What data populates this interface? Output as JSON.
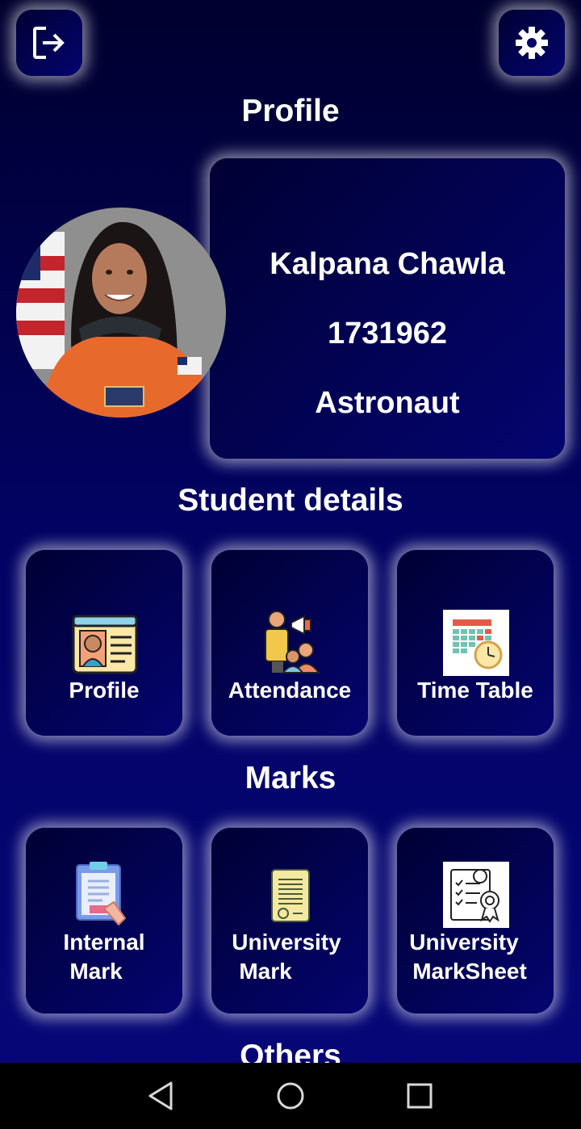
{
  "header": {
    "logout_icon": "logout-icon",
    "settings_icon": "gear-icon",
    "profile_title": "Profile"
  },
  "profile": {
    "name": "Kalpana Chawla",
    "id": "1731962",
    "role": "Astronaut"
  },
  "student_details": {
    "title": "Student details",
    "tiles": [
      {
        "label": "Profile",
        "icon": "profile-card-icon"
      },
      {
        "label": "Attendance",
        "icon": "attendance-icon"
      },
      {
        "label": "Time Table",
        "icon": "calendar-clock-icon"
      }
    ]
  },
  "marks": {
    "title": "Marks",
    "tiles": [
      {
        "line1": "Internal",
        "line2": "Mark",
        "icon": "clipboard-icon"
      },
      {
        "line1": "University",
        "line2": "Mark",
        "icon": "certificate-icon"
      },
      {
        "line1": "University",
        "line2": "MarkSheet",
        "icon": "marksheet-icon"
      }
    ]
  },
  "others": {
    "title": "Others"
  },
  "navbar": {
    "back_icon": "back-triangle-icon",
    "home_icon": "home-circle-icon",
    "recents_icon": "recents-square-icon"
  },
  "colors": {
    "background": "#02024f",
    "card": "#040470",
    "glow": "#ffffff"
  }
}
